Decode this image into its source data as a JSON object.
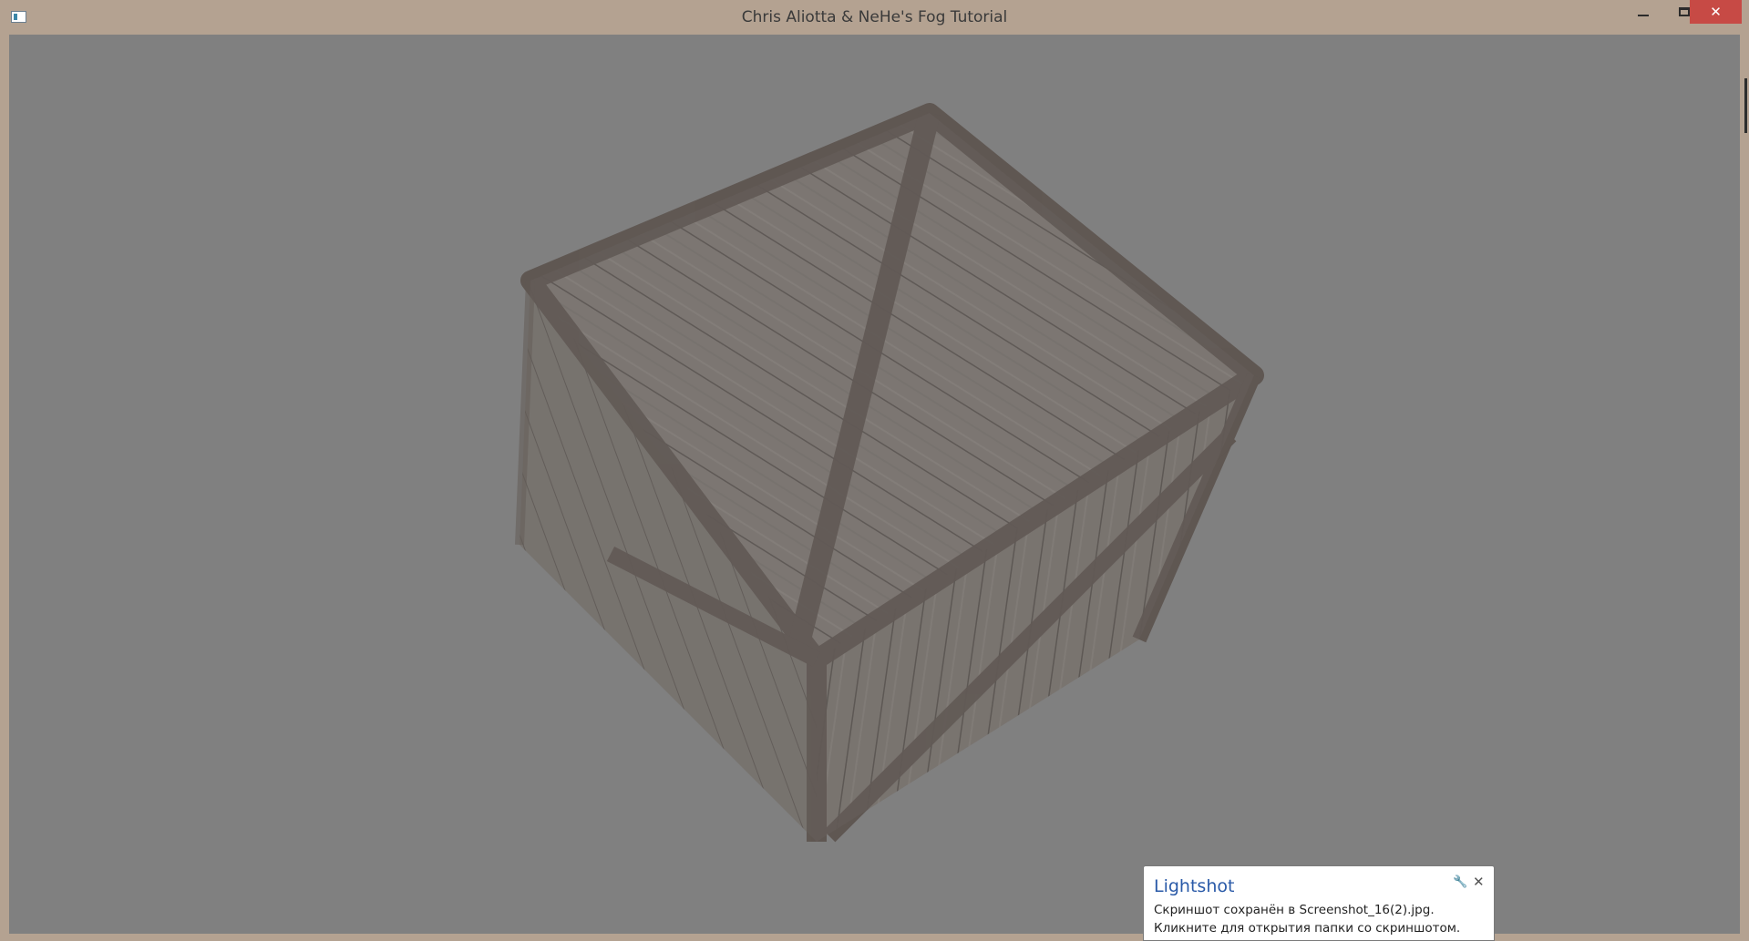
{
  "window": {
    "title": "Chris Aliotta & NeHe's Fog Tutorial",
    "icon": "app-window-icon",
    "controls": {
      "minimize": "minimize-icon",
      "maximize": "maximize-icon",
      "close": "✕"
    }
  },
  "scene": {
    "description_icon": "textured-wooden-crate-3d",
    "background_color": "#808080"
  },
  "notification": {
    "app_name": "Lightshot",
    "message": "Скриншот сохранён в Screenshot_16(2).jpg. Кликните для открытия папки со скриншотом.",
    "pin_icon": "🔧",
    "close_icon": "✕"
  }
}
